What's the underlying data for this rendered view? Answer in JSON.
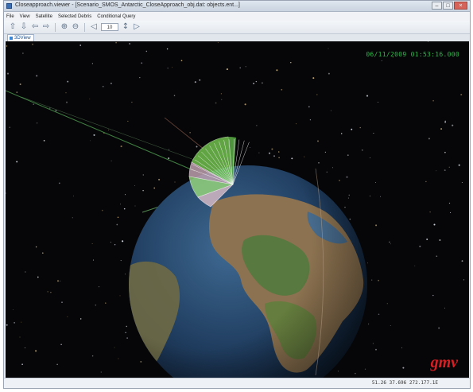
{
  "window": {
    "title": "Closeapproach.viewer - [Scenario_SMOS_Antarctic_CloseApproach_obj.dat: objects.ent...]",
    "controls": {
      "minimize": "–",
      "maximize": "□",
      "close": "×"
    }
  },
  "menu": [
    "File",
    "View",
    "Satellite",
    "Selected Debris",
    "Conditional Query"
  ],
  "toolbar": {
    "icons": [
      "arrow-up-icon",
      "arrow-down-icon",
      "arrow-left-icon",
      "arrow-right-icon",
      "zoom-in-icon",
      "zoom-out-icon"
    ],
    "step_value": "10"
  },
  "tab": {
    "label": "3DView"
  },
  "viewport": {
    "time_readout": "06/11/2009 01:53:16.000",
    "logo": "gmv",
    "earth_ocean_color": "#1f3c5e",
    "land_color": "#8c7250",
    "fan_color": "#7ed957"
  },
  "statusbar": {
    "text": "51.26 37.696 272.177.1E"
  }
}
